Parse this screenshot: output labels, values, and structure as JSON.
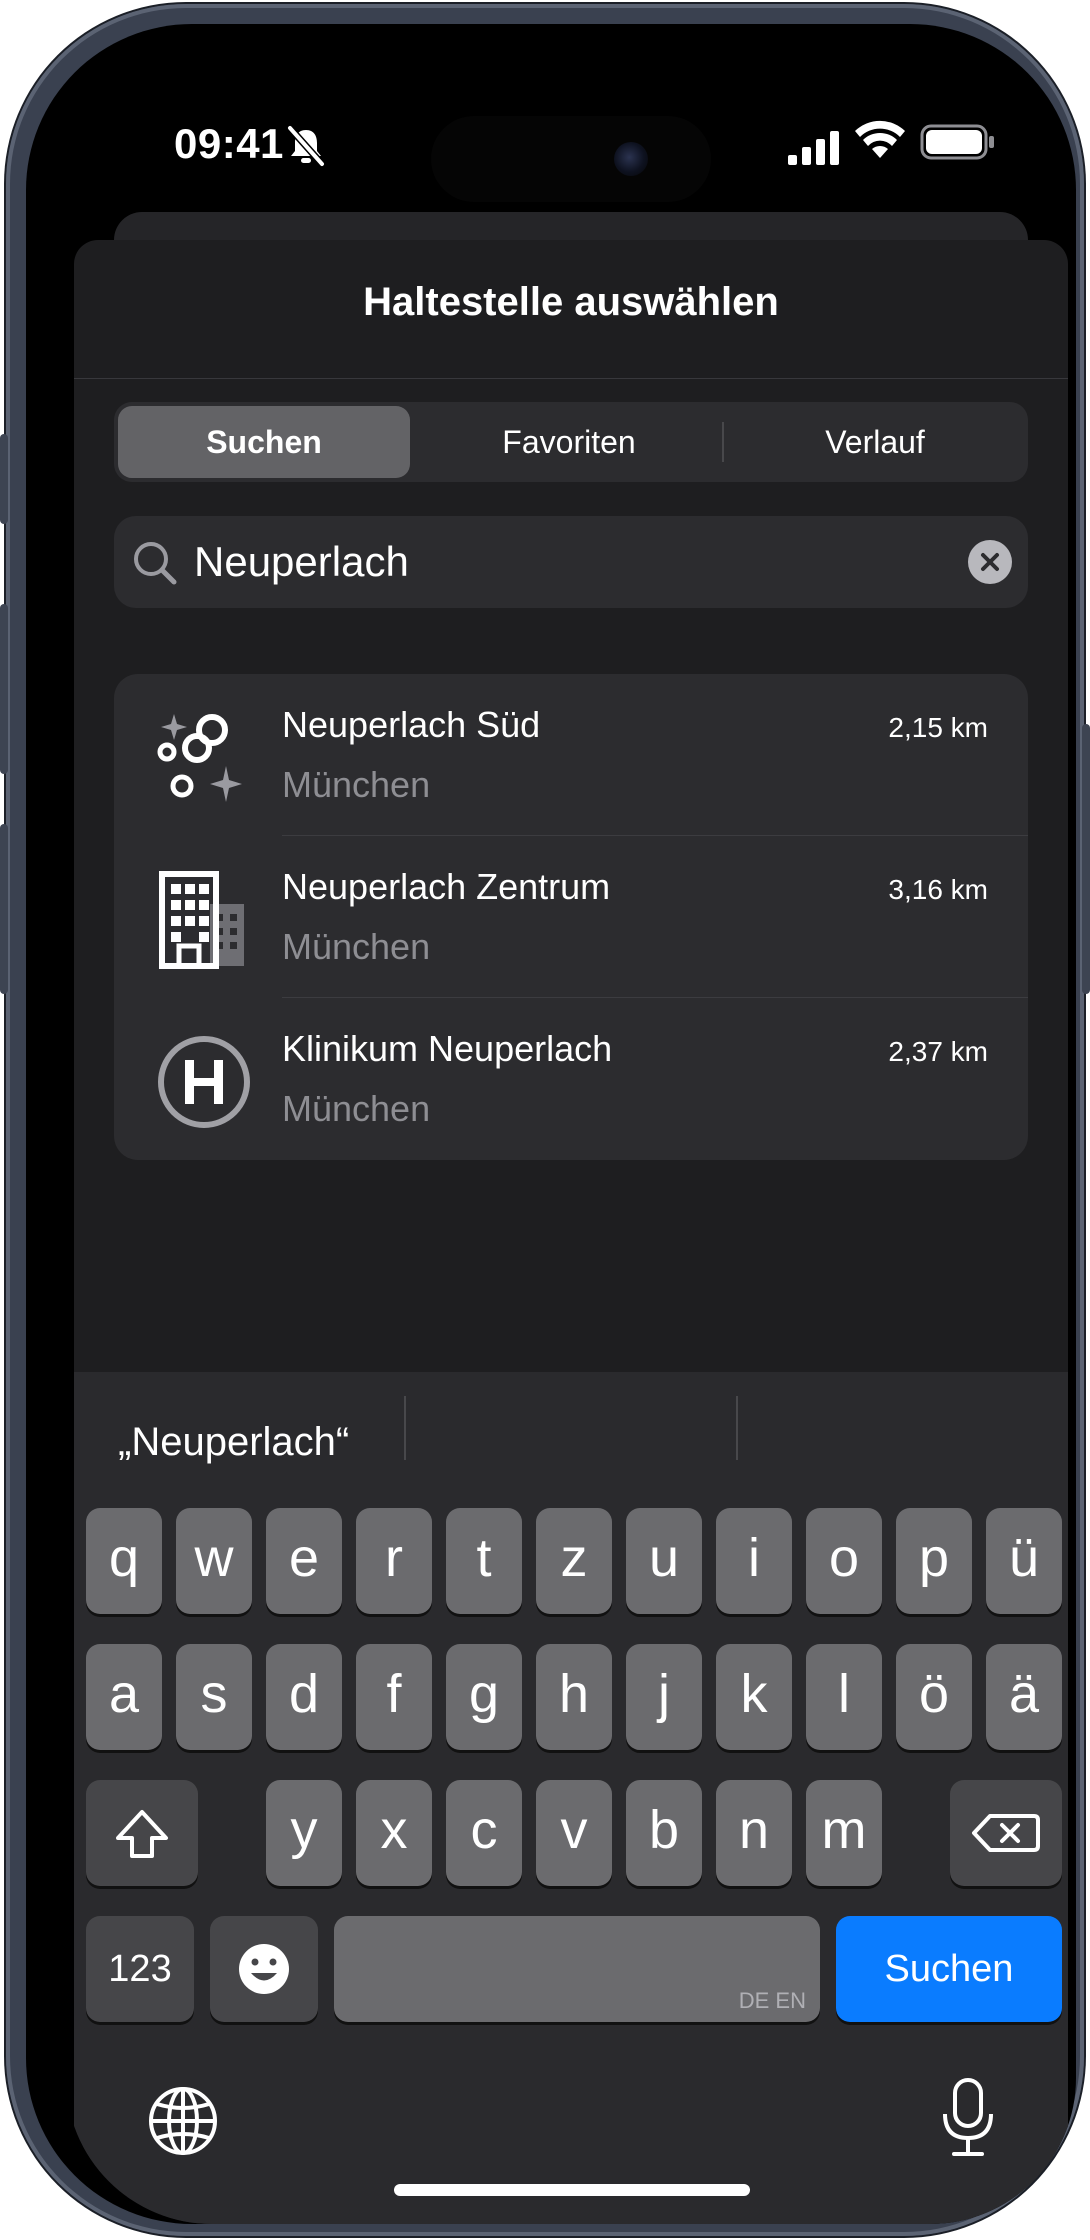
{
  "status": {
    "time": "09:41"
  },
  "sheet": {
    "title": "Haltestelle auswählen"
  },
  "tabs": [
    {
      "label": "Suchen",
      "active": true
    },
    {
      "label": "Favoriten",
      "active": false
    },
    {
      "label": "Verlauf",
      "active": false
    }
  ],
  "search": {
    "value": "Neuperlach"
  },
  "results": [
    {
      "name": "Neuperlach Süd",
      "city": "München",
      "distance": "2,15 km",
      "icon": "bubbles-sparkles-icon"
    },
    {
      "name": "Neuperlach Zentrum",
      "city": "München",
      "distance": "3,16 km",
      "icon": "building-icon"
    },
    {
      "name": "Klinikum Neuperlach",
      "city": "München",
      "distance": "2,37 km",
      "icon": "hospital-h-icon"
    }
  ],
  "keyboard": {
    "suggestion": "„Neuperlach“",
    "row1": [
      "q",
      "w",
      "e",
      "r",
      "t",
      "z",
      "u",
      "i",
      "o",
      "p",
      "ü"
    ],
    "row2": [
      "a",
      "s",
      "d",
      "f",
      "g",
      "h",
      "j",
      "k",
      "l",
      "ö",
      "ä"
    ],
    "row3": [
      "y",
      "x",
      "c",
      "v",
      "b",
      "n",
      "m"
    ],
    "numbers_label": "123",
    "space_label": "DE EN",
    "return_label": "Suchen"
  },
  "colors": {
    "accent": "#0a7cff",
    "sheet": "#1e1e20",
    "card": "#2c2c2f"
  }
}
